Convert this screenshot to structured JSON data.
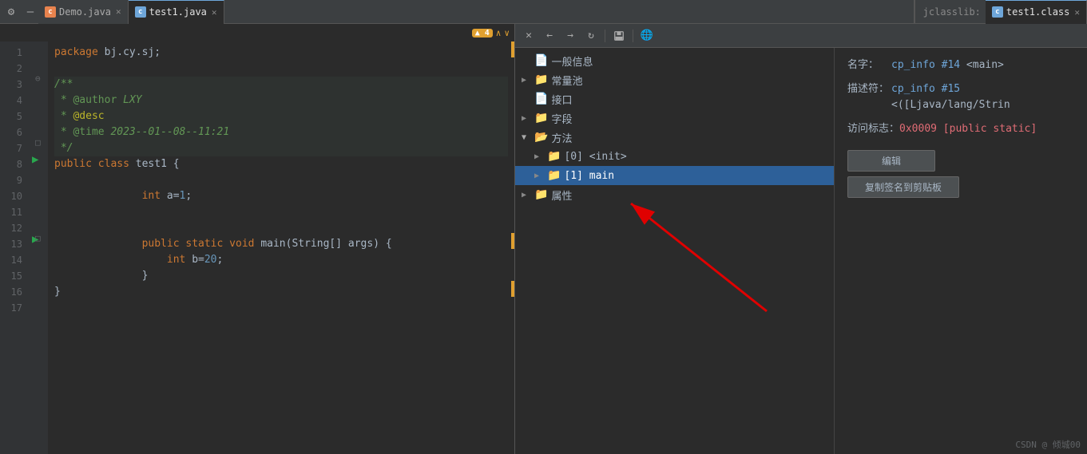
{
  "tabs_left": [
    {
      "id": "demo",
      "label": "Demo.java",
      "icon": "java",
      "active": false,
      "closable": true
    },
    {
      "id": "test1",
      "label": "test1.java",
      "icon": "java",
      "active": true,
      "closable": true
    }
  ],
  "tabs_right": [
    {
      "id": "jclasslib",
      "label": "jclasslib:",
      "is_label": true
    },
    {
      "id": "test1class",
      "label": "test1.class",
      "icon": "class",
      "active": true,
      "closable": true
    }
  ],
  "warnings": {
    "count": "▲ 4",
    "up": "^",
    "down": "v"
  },
  "code_lines": [
    {
      "num": "1",
      "content": "package bj.cy.sj;",
      "type": "normal"
    },
    {
      "num": "2",
      "content": "",
      "type": "normal"
    },
    {
      "num": "3",
      "content": "/**",
      "type": "comment"
    },
    {
      "num": "4",
      "content": " * @author LXY",
      "type": "comment"
    },
    {
      "num": "5",
      "content": " * @desc",
      "type": "comment"
    },
    {
      "num": "6",
      "content": " * @time 2023--01--08--11:21",
      "type": "comment"
    },
    {
      "num": "7",
      "content": " */",
      "type": "comment"
    },
    {
      "num": "8",
      "content": "public class test1 {",
      "type": "normal",
      "run": true
    },
    {
      "num": "9",
      "content": "",
      "type": "normal"
    },
    {
      "num": "10",
      "content": "    int a=1;",
      "type": "normal"
    },
    {
      "num": "11",
      "content": "",
      "type": "normal"
    },
    {
      "num": "12",
      "content": "",
      "type": "normal"
    },
    {
      "num": "13",
      "content": "    public static void main(String[] args) {",
      "type": "normal",
      "run": true
    },
    {
      "num": "14",
      "content": "        int b=20;",
      "type": "normal"
    },
    {
      "num": "15",
      "content": "    }",
      "type": "normal"
    },
    {
      "num": "16",
      "content": "}",
      "type": "normal"
    },
    {
      "num": "17",
      "content": "",
      "type": "normal"
    }
  ],
  "toolbar_buttons": [
    {
      "name": "close",
      "icon": "✕"
    },
    {
      "name": "back",
      "icon": "←"
    },
    {
      "name": "forward",
      "icon": "→"
    },
    {
      "name": "refresh",
      "icon": "↻"
    },
    {
      "name": "save",
      "icon": "💾"
    },
    {
      "name": "globe",
      "icon": "🌐"
    }
  ],
  "tree_items": [
    {
      "id": "general",
      "label": "一般信息",
      "level": 0,
      "hasArrow": false,
      "isFolder": true,
      "expanded": false
    },
    {
      "id": "constpool",
      "label": "常量池",
      "level": 0,
      "hasArrow": true,
      "isFolder": true,
      "expanded": false
    },
    {
      "id": "interface",
      "label": "接口",
      "level": 0,
      "hasArrow": false,
      "isFolder": true,
      "expanded": false
    },
    {
      "id": "fields",
      "label": "字段",
      "level": 0,
      "hasArrow": true,
      "isFolder": true,
      "expanded": false
    },
    {
      "id": "methods",
      "label": "方法",
      "level": 0,
      "hasArrow": true,
      "isFolder": true,
      "expanded": true
    },
    {
      "id": "init",
      "label": "[0] <init>",
      "level": 1,
      "hasArrow": true,
      "isFolder": true,
      "expanded": false
    },
    {
      "id": "main",
      "label": "[1] main",
      "level": 1,
      "hasArrow": true,
      "isFolder": true,
      "expanded": false,
      "selected": true
    },
    {
      "id": "attributes",
      "label": "属性",
      "level": 0,
      "hasArrow": true,
      "isFolder": true,
      "expanded": false
    }
  ],
  "props": {
    "name_label": "名字：",
    "name_value": "cp_info #14 <main>",
    "desc_label": "描述符：",
    "desc_value": "cp_info #15 <([Ljava/lang/Strin",
    "access_label": "访问标志：",
    "access_value": "0x0009 [public static]",
    "btn_edit": "编辑",
    "btn_copy": "复制签名到剪贴板"
  },
  "watermark": "CSDN @ 倾城00"
}
